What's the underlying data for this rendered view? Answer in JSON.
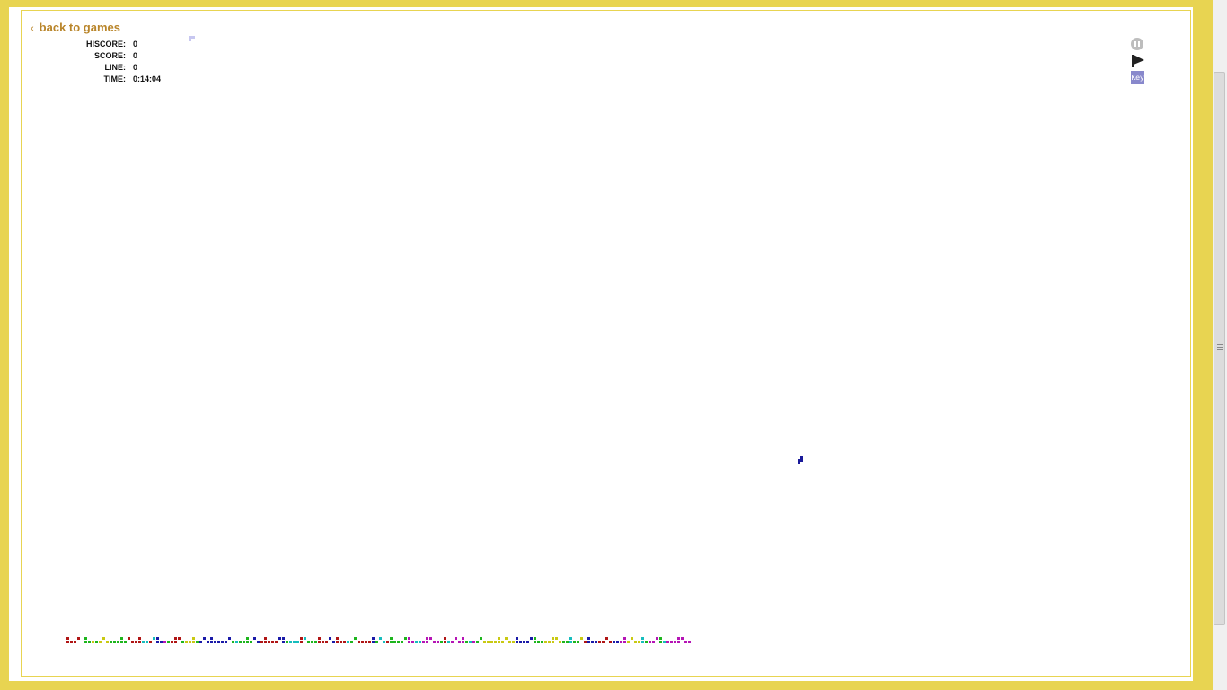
{
  "nav": {
    "back_label": "back to games"
  },
  "stats": [
    {
      "label": "HISCORE:",
      "value": "0"
    },
    {
      "label": "SCORE:",
      "value": "0"
    },
    {
      "label": "LINE:",
      "value": "0"
    },
    {
      "label": "TIME:",
      "value": "0:14:04"
    }
  ],
  "controls": {
    "pause": "pause-icon",
    "play": "flag-icon",
    "key_label": "Key"
  },
  "colors": {
    "background": "#e8d451",
    "link": "#b9852a",
    "falling_piece": "#1a1a9a",
    "piece_palette": [
      "#b01515",
      "#1db51d",
      "#c9c912",
      "#1a1aa8",
      "#16bdbd",
      "#b514b5",
      "#b8b8b8"
    ]
  },
  "board": {
    "bottom_row": "rrrr.ggygyyygggggrrrrccrcbbmgrrrgyyygbbbbbbbbbgcggggbbrrrrrbbgcccrcgggrrrbbrrrcggrrrrbgccrgggggmmccmmmmmgrcmmmmgcmggyyyyyyyyybbbbbgggyyyyyggcggyrbbbrrrrbbmmyyyycgmmmgcmmmmmmm"
  }
}
